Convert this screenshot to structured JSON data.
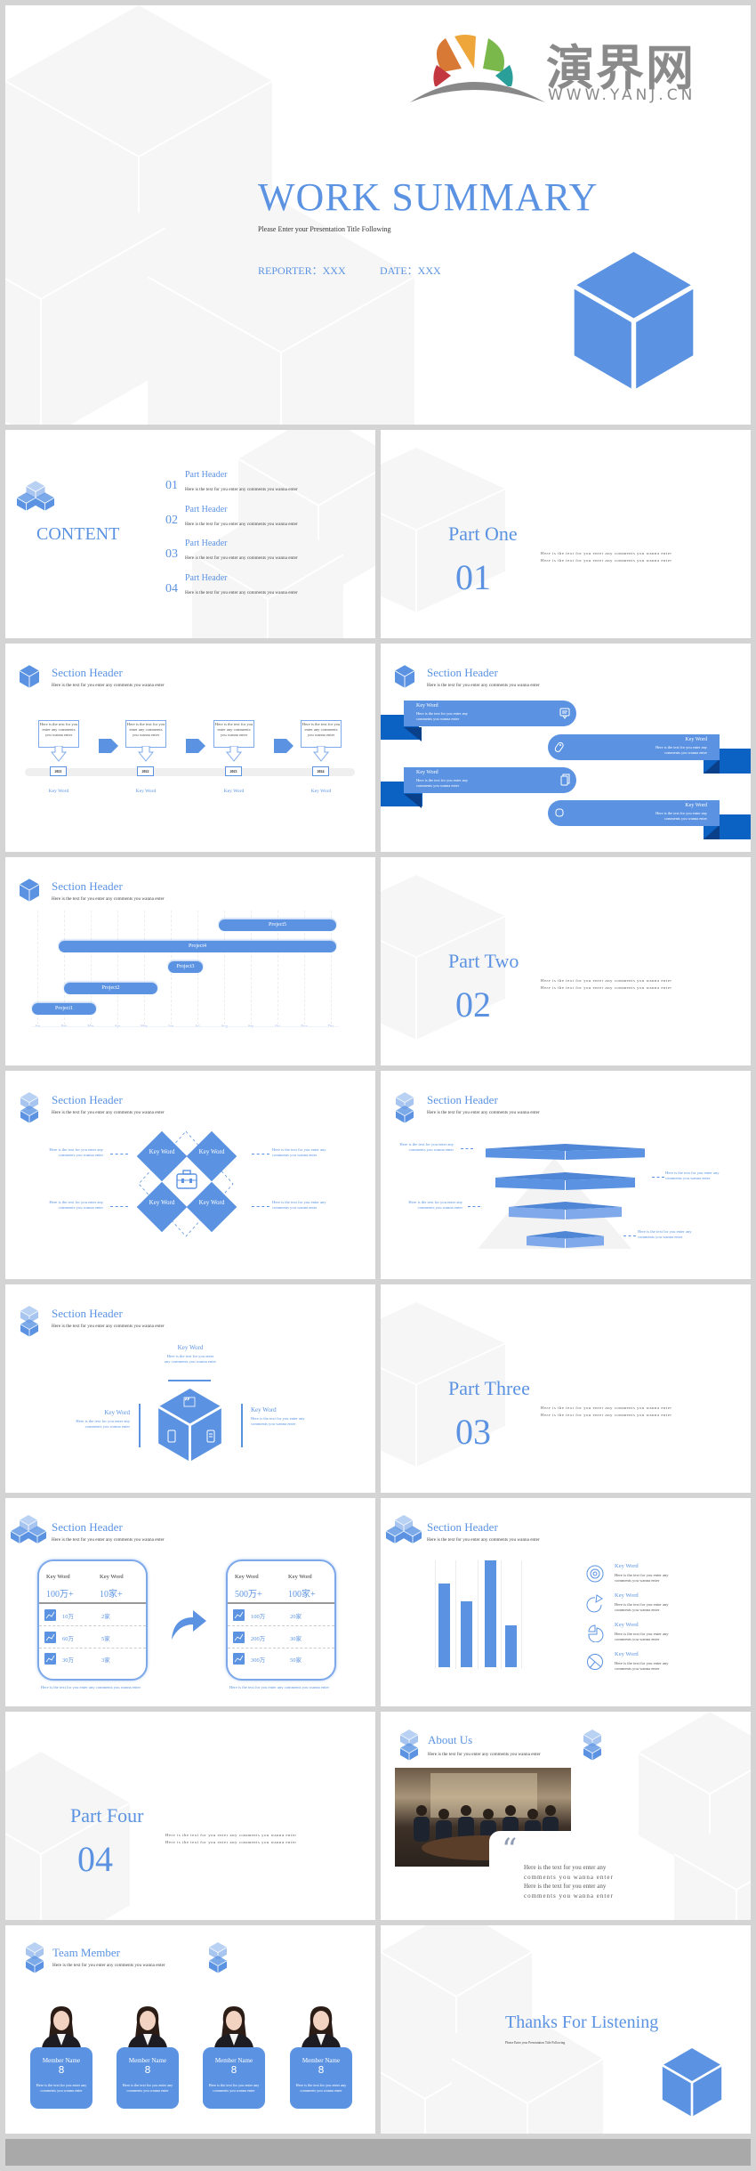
{
  "colors": {
    "accent": "#5b93e2",
    "accent_dark": "#0b62c2",
    "accent_light": "#a8c5f0",
    "page_bg": "#d4d4d4",
    "footer_bar": "#a9a9a9"
  },
  "cover": {
    "logo_text": "演界网",
    "logo_url": "WWW.YANJ.CN",
    "title": "WORK SUMMARY",
    "subtitle": "Please Enter your Presentation Title Following",
    "reporter": "REPORTER：XXX",
    "date": "DATE：XXX"
  },
  "contents": {
    "title": "CONTENT",
    "items": [
      {
        "num": "01",
        "label": "Part Header",
        "desc": "Here is the text for you enter any comments you wanna enter"
      },
      {
        "num": "02",
        "label": "Part Header",
        "desc": "Here is the text for you enter any comments you wanna enter"
      },
      {
        "num": "03",
        "label": "Part Header",
        "desc": "Here is the text for you enter any comments you wanna enter"
      },
      {
        "num": "04",
        "label": "Part Header",
        "desc": "Here is the text for you enter any comments you wanna enter"
      }
    ]
  },
  "parts": [
    {
      "title": "Part One",
      "num": "01",
      "lines": [
        "Here is the text for you enter any comments you wanna enter",
        "Here is the text for you enter any comments you wanna enter"
      ]
    },
    {
      "title": "Part Two",
      "num": "02",
      "lines": [
        "Here is the text for you enter any comments you wanna enter",
        "Here is the text for you enter any comments you wanna enter"
      ]
    },
    {
      "title": "Part Three",
      "num": "03",
      "lines": [
        "Here is the text for you enter any comments you wanna enter",
        "Here is the text for you enter any comments you wanna enter"
      ]
    },
    {
      "title": "Part Four",
      "num": "04",
      "lines": [
        "Here is the text for you enter any comments you wanna enter",
        "Here is the text for you enter any comments you wanna enter"
      ]
    }
  ],
  "timeline": {
    "header": "Section Header",
    "subheader": "Here is the text for you enter any comments you wanna enter",
    "steps": [
      {
        "text": "Here is the text for you enter any comments you wanna enter",
        "year": "2021",
        "label": "Key Word"
      },
      {
        "text": "Here is the text for you enter any comments you wanna enter",
        "year": "2022",
        "label": "Key Word"
      },
      {
        "text": "Here is the text for you enter any comments you wanna enter",
        "year": "2023",
        "label": "Key Word"
      },
      {
        "text": "Here is the text for you enter any comments you wanna enter",
        "year": "2024",
        "label": "Key Word"
      }
    ]
  },
  "ribbons": {
    "header": "Section Header",
    "subheader": "Here is the text for you enter any comments you wanna enter",
    "items": [
      {
        "label": "Key Word",
        "text": "Here is the text for you enter any comments you wanna enter",
        "icon": "chat-icon"
      },
      {
        "label": "Key Word",
        "text": "Here is the text for you enter any comments you wanna enter",
        "icon": "tag-icon"
      },
      {
        "label": "Key Word",
        "text": "Here is the text for you enter any comments you wanna enter",
        "icon": "document-icon"
      },
      {
        "label": "Key Word",
        "text": "Here is the text for you enter any comments you wanna enter",
        "icon": "refresh-icon"
      }
    ]
  },
  "gantt": {
    "header": "Section Header",
    "subheader": "Here is the text for you enter any comments you wanna enter",
    "months": [
      "Jan",
      "Feb",
      "Mar",
      "Apr",
      "May",
      "Jun",
      "Jul",
      "Aug",
      "Sep",
      "Oct",
      "Nov",
      "Dec"
    ],
    "projects": [
      {
        "name": "Project5",
        "start": 7.8,
        "end": 12.2
      },
      {
        "name": "Project4",
        "start": 1.8,
        "end": 12.2
      },
      {
        "name": "Project3",
        "start": 5.9,
        "end": 7.2
      },
      {
        "name": "Project2",
        "start": 2,
        "end": 5.5
      },
      {
        "name": "Project1",
        "start": 0.8,
        "end": 3.2
      }
    ]
  },
  "diamonds": {
    "header": "Section Header",
    "subheader": "Here is the text for you enter any comments you wanna enter",
    "center_icon": "briefcase-icon",
    "labels": [
      "Key Word",
      "Key Word",
      "Key Word",
      "Key Word"
    ],
    "notes": [
      "Here is the text for you enter any comments you wanna enter",
      "Here is the text for you enter any comments you wanna enter",
      "Here is the text for you enter any comments you wanna enter",
      "Here is the text for you enter any comments you wanna enter"
    ]
  },
  "layers": {
    "header": "Section Header",
    "subheader": "Here is the text for you enter any comments you wanna enter",
    "notes": [
      "Here is the text for you enter any comments you wanna enter",
      "Here is the text for you enter any comments you wanna enter",
      "Here is the text for you enter any comments you wanna enter",
      "Here is the text for you enter any comments you wanna enter"
    ]
  },
  "cube": {
    "header": "Section Header",
    "subheader": "Here is the text for you enter any comments you wanna enter",
    "items": [
      {
        "label": "Key Word",
        "text": "Here is the text for you enter any comments you wanna enter"
      },
      {
        "label": "Key Word",
        "text": "Here is the text for you enter any comments you wanna enter"
      },
      {
        "label": "Key Word",
        "text": "Here is the text for you enter any comments you wanna enter"
      }
    ]
  },
  "stats": {
    "header": "Section Header",
    "subheader": "Here is the text for you enter any comments you wanna enter",
    "cards": [
      {
        "headers": [
          "Key Word",
          "Key Word"
        ],
        "totals": [
          "100万+",
          "10家+"
        ],
        "rows": [
          [
            "10万",
            "2家"
          ],
          [
            "60万",
            "5家"
          ],
          [
            "30万",
            "3家"
          ]
        ],
        "caption": "Here is the text for you enter any comments you wanna enter"
      },
      {
        "headers": [
          "Key Word",
          "Key Word"
        ],
        "totals": [
          "500万+",
          "100家+"
        ],
        "rows": [
          [
            "100万",
            "20家"
          ],
          [
            "200万",
            "30家"
          ],
          [
            "300万",
            "50家"
          ]
        ],
        "caption": "Here is the text for you enter any comments you wanna enter"
      }
    ]
  },
  "bars": {
    "header": "Section Header",
    "subheader": "Here is the text for you enter any comments you wanna enter",
    "values": [
      78,
      62,
      100,
      39
    ],
    "items": [
      {
        "label": "Key Word",
        "text": "Here is the text for you enter any comments you wanna enter",
        "icon": "target-icon"
      },
      {
        "label": "Key Word",
        "text": "Here is the text for you enter any comments you wanna enter",
        "icon": "pie-chart-icon"
      },
      {
        "label": "Key Word",
        "text": "Here is the text for you enter any comments you wanna enter",
        "icon": "pie-segment-icon"
      },
      {
        "label": "Key Word",
        "text": "Here is the text for you enter any comments you wanna enter",
        "icon": "radar-icon"
      }
    ]
  },
  "about": {
    "title": "About Us",
    "subtitle": "Here is the text for you enter any comments you wanna enter",
    "quote_lines": [
      "Here is the text for you enter any",
      "comments you wanna enter",
      "Here is the text for you enter any",
      "comments you wanna enter"
    ]
  },
  "team": {
    "title": "Team Member",
    "subtitle": "Here is the text for you enter any comments you wanna enter",
    "members": [
      {
        "name": "Member Name",
        "mark": "8",
        "text": "Here is the text for you enter any comments you wanna enter"
      },
      {
        "name": "Member Name",
        "mark": "8",
        "text": "Here is the text for you enter any comments you wanna enter"
      },
      {
        "name": "Member Name",
        "mark": "8",
        "text": "Here is the text for you enter any comments you wanna enter"
      },
      {
        "name": "Member Name",
        "mark": "8",
        "text": "Here is the text for you enter any comments you wanna enter"
      }
    ]
  },
  "thanks": {
    "title": "Thanks For Listening",
    "subtitle": "Please Enter your Presentation Title Following"
  }
}
